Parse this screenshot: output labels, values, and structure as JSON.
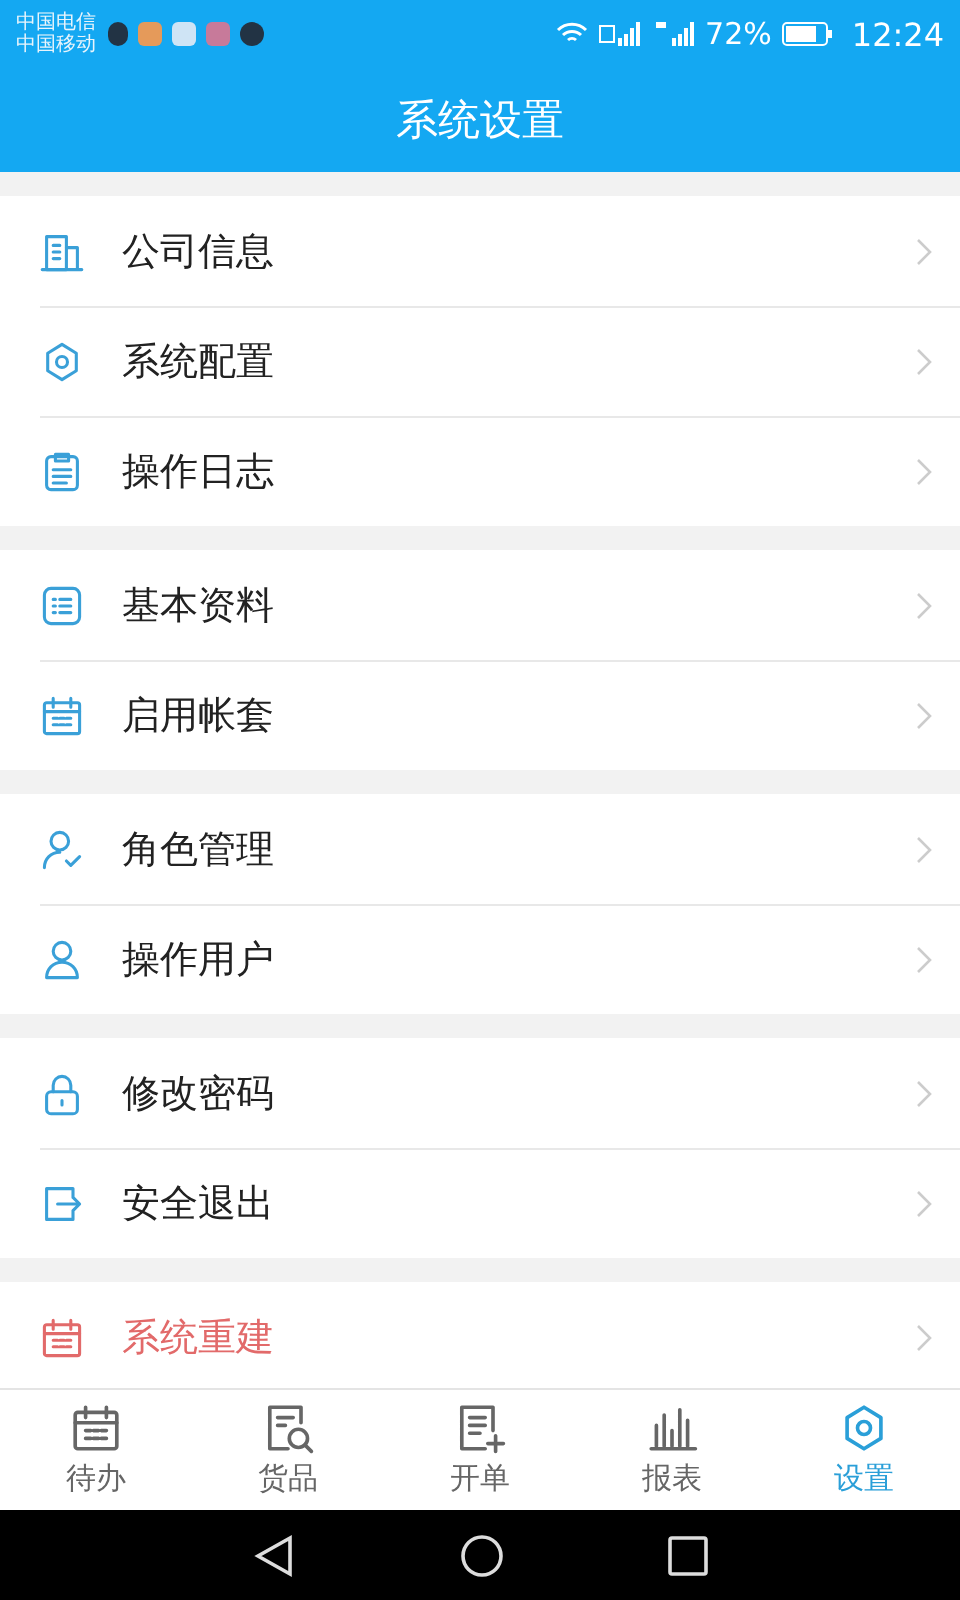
{
  "status_bar": {
    "carriers": [
      "中国电信",
      "中国移动"
    ],
    "battery": "72%",
    "time": "12:24"
  },
  "header": {
    "title": "系统设置"
  },
  "groups": [
    {
      "items": [
        {
          "label": "公司信息",
          "kind": "normal"
        },
        {
          "label": "系统配置",
          "kind": "normal"
        },
        {
          "label": "操作日志",
          "kind": "normal"
        }
      ]
    },
    {
      "items": [
        {
          "label": "基本资料",
          "kind": "normal"
        },
        {
          "label": "启用帐套",
          "kind": "normal"
        }
      ]
    },
    {
      "items": [
        {
          "label": "角色管理",
          "kind": "normal"
        },
        {
          "label": "操作用户",
          "kind": "normal"
        }
      ]
    },
    {
      "items": [
        {
          "label": "修改密码",
          "kind": "normal"
        },
        {
          "label": "安全退出",
          "kind": "normal"
        }
      ]
    },
    {
      "items": [
        {
          "label": "系统重建",
          "kind": "danger"
        }
      ]
    }
  ],
  "tabs": [
    {
      "label": "待办",
      "selected": false
    },
    {
      "label": "货品",
      "selected": false
    },
    {
      "label": "开单",
      "selected": false
    },
    {
      "label": "报表",
      "selected": false
    },
    {
      "label": "设置",
      "selected": true
    }
  ]
}
